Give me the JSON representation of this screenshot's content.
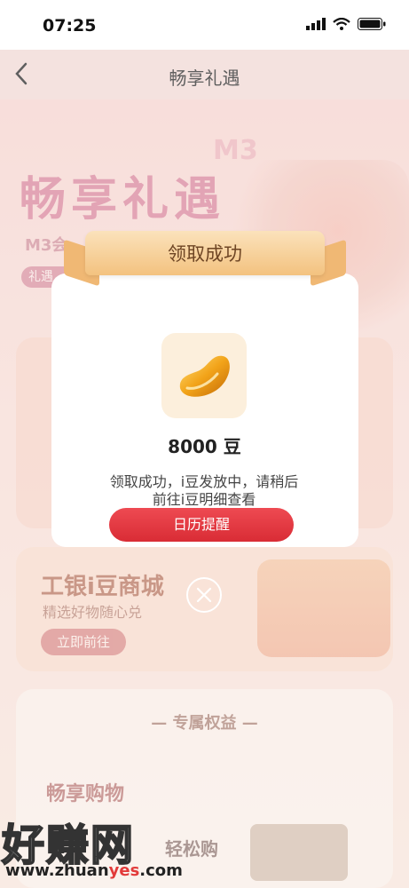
{
  "status_bar": {
    "time": "07:25"
  },
  "nav": {
    "title": "畅享礼遇"
  },
  "background": {
    "banner_title": "畅享礼遇",
    "banner_sub": "M3会",
    "banner_pill": "礼遇",
    "m3_badge": "M3",
    "mall_title": "工银i豆商城",
    "mall_sub": "精选好物随心兑",
    "mall_button": "立即前往",
    "benefits_title": "— 专属权益 —",
    "shop_title": "畅享购物",
    "shop_partial": "轻松购"
  },
  "modal": {
    "ribbon_title": "领取成功",
    "amount": "8000 豆",
    "message_line1": "领取成功，i豆发放中，请稍后",
    "message_line2": "前往i豆明细查看",
    "calendar_button": "日历提醒"
  },
  "watermark": {
    "text": "好赚网",
    "url_prefix": "www.zhuan",
    "url_highlight": "yes",
    "url_suffix": ".com"
  },
  "colors": {
    "primary_red": "#e03a42",
    "ribbon_gold": "#f3c27f"
  }
}
